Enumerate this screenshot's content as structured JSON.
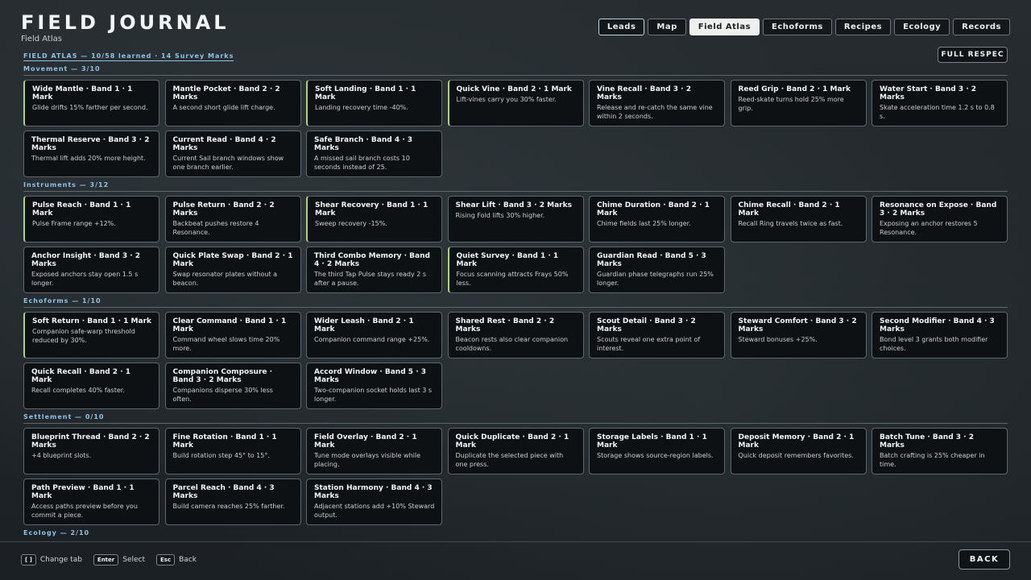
{
  "header": {
    "title": "FIELD JOURNAL",
    "subtitle": "Field Atlas"
  },
  "tabs": [
    {
      "label": "Leads",
      "state": "focus"
    },
    {
      "label": "Map",
      "state": ""
    },
    {
      "label": "Field Atlas",
      "state": "active"
    },
    {
      "label": "Echoforms",
      "state": ""
    },
    {
      "label": "Recipes",
      "state": ""
    },
    {
      "label": "Ecology",
      "state": ""
    },
    {
      "label": "Records",
      "state": ""
    }
  ],
  "summary": "FIELD ATLAS — 10/58 learned · 14 Survey Marks",
  "respec_label": "FULL RESPEC",
  "sections": [
    {
      "heading": "Movement — 3/10",
      "cards": [
        {
          "title": "Wide Mantle · Band 1 · 1 Mark",
          "desc": "Glide drifts 15% farther per second.",
          "learned": true
        },
        {
          "title": "Mantle Pocket · Band 2 · 2 Marks",
          "desc": "A second short glide lift charge.",
          "learned": false
        },
        {
          "title": "Soft Landing · Band 1 · 1 Mark",
          "desc": "Landing recovery time -40%.",
          "learned": true
        },
        {
          "title": "Quick Vine · Band 2 · 1 Mark",
          "desc": "Lift-vines carry you 30% faster.",
          "learned": true
        },
        {
          "title": "Vine Recall · Band 3 · 2 Marks",
          "desc": "Release and re-catch the same vine within 2 seconds.",
          "learned": false
        },
        {
          "title": "Reed Grip · Band 2 · 1 Mark",
          "desc": "Reed-skate turns hold 25% more grip.",
          "learned": false
        },
        {
          "title": "Water Start · Band 3 · 2 Marks",
          "desc": "Skate acceleration time 1.2 s to 0.8 s.",
          "learned": false
        },
        {
          "title": "Thermal Reserve · Band 3 · 2 Marks",
          "desc": "Thermal lift adds 20% more height.",
          "learned": false
        },
        {
          "title": "Current Read · Band 4 · 2 Marks",
          "desc": "Current Sail branch windows show one branch earlier.",
          "learned": false
        },
        {
          "title": "Safe Branch · Band 4 · 3 Marks",
          "desc": "A missed sail branch costs 10 seconds instead of 25.",
          "learned": false
        }
      ]
    },
    {
      "heading": "Instruments — 3/12",
      "cards": [
        {
          "title": "Pulse Reach · Band 1 · 1 Mark",
          "desc": "Pulse Frame range +12%.",
          "learned": true
        },
        {
          "title": "Pulse Return · Band 2 · 2 Marks",
          "desc": "Backbeat pushes restore 4 Resonance.",
          "learned": false
        },
        {
          "title": "Shear Recovery · Band 1 · 1 Mark",
          "desc": "Sweep recovery -15%.",
          "learned": true
        },
        {
          "title": "Shear Lift · Band 3 · 2 Marks",
          "desc": "Rising Fold lifts 30% higher.",
          "learned": false
        },
        {
          "title": "Chime Duration · Band 2 · 1 Mark",
          "desc": "Chime fields last 25% longer.",
          "learned": false
        },
        {
          "title": "Chime Recall · Band 2 · 1 Mark",
          "desc": "Recall Ring travels twice as fast.",
          "learned": false
        },
        {
          "title": "Resonance on Expose · Band 3 · 2 Marks",
          "desc": "Exposing an anchor restores 5 Resonance.",
          "learned": false
        },
        {
          "title": "Anchor Insight · Band 3 · 2 Marks",
          "desc": "Exposed anchors stay open 1.5 s longer.",
          "learned": false
        },
        {
          "title": "Quick Plate Swap · Band 2 · 1 Mark",
          "desc": "Swap resonator plates without a beacon.",
          "learned": false
        },
        {
          "title": "Third Combo Memory · Band 4 · 2 Marks",
          "desc": "The third Tap Pulse stays ready 2 s after a pause.",
          "learned": false
        },
        {
          "title": "Quiet Survey · Band 1 · 1 Mark",
          "desc": "Focus scanning attracts Frays 50% less.",
          "learned": true
        },
        {
          "title": "Guardian Read · Band 5 · 3 Marks",
          "desc": "Guardian phase telegraphs run 25% longer.",
          "learned": false
        }
      ]
    },
    {
      "heading": "Echoforms — 1/10",
      "cards": [
        {
          "title": "Soft Return · Band 1 · 1 Mark",
          "desc": "Companion safe-warp threshold reduced by 30%.",
          "learned": true
        },
        {
          "title": "Clear Command · Band 1 · 1 Mark",
          "desc": "Command wheel slows time 20% more.",
          "learned": false
        },
        {
          "title": "Wider Leash · Band 2 · 1 Mark",
          "desc": "Companion command range +25%.",
          "learned": false
        },
        {
          "title": "Shared Rest · Band 2 · 2 Marks",
          "desc": "Beacon rests also clear companion cooldowns.",
          "learned": false
        },
        {
          "title": "Scout Detail · Band 3 · 2 Marks",
          "desc": "Scouts reveal one extra point of interest.",
          "learned": false
        },
        {
          "title": "Steward Comfort · Band 3 · 2 Marks",
          "desc": "Steward bonuses +25%.",
          "learned": false
        },
        {
          "title": "Second Modifier · Band 4 · 3 Marks",
          "desc": "Bond level 3 grants both modifier choices.",
          "learned": false
        },
        {
          "title": "Quick Recall · Band 2 · 1 Mark",
          "desc": "Recall completes 40% faster.",
          "learned": false
        },
        {
          "title": "Companion Composure · Band 3 · 2 Marks",
          "desc": "Companions disperse 30% less often.",
          "learned": false
        },
        {
          "title": "Accord Window · Band 5 · 3 Marks",
          "desc": "Two-companion socket holds last 3 s longer.",
          "learned": false
        }
      ]
    },
    {
      "heading": "Settlement — 0/10",
      "cards": [
        {
          "title": "Blueprint Thread · Band 2 · 2 Marks",
          "desc": "+4 blueprint slots.",
          "learned": false
        },
        {
          "title": "Fine Rotation · Band 1 · 1 Mark",
          "desc": "Build rotation step 45° to 15°.",
          "learned": false
        },
        {
          "title": "Field Overlay · Band 2 · 1 Mark",
          "desc": "Tune mode overlays visible while placing.",
          "learned": false
        },
        {
          "title": "Quick Duplicate · Band 2 · 1 Mark",
          "desc": "Duplicate the selected piece with one press.",
          "learned": false
        },
        {
          "title": "Storage Labels · Band 1 · 1 Mark",
          "desc": "Storage shows source-region labels.",
          "learned": false
        },
        {
          "title": "Deposit Memory · Band 2 · 1 Mark",
          "desc": "Quick deposit remembers favorites.",
          "learned": false
        },
        {
          "title": "Batch Tune · Band 3 · 2 Marks",
          "desc": "Batch crafting is 25% cheaper in time.",
          "learned": false
        },
        {
          "title": "Path Preview · Band 1 · 1 Mark",
          "desc": "Access paths preview before you commit a piece.",
          "learned": false
        },
        {
          "title": "Parcel Reach · Band 4 · 3 Marks",
          "desc": "Build camera reaches 25% farther.",
          "learned": false
        },
        {
          "title": "Station Harmony · Band 4 · 3 Marks",
          "desc": "Adjacent stations add +10% Steward output.",
          "learned": false
        }
      ]
    },
    {
      "heading": "Ecology — 2/10",
      "cards": []
    }
  ],
  "footer": {
    "hints": [
      {
        "key": "[ ]",
        "label": "Change tab"
      },
      {
        "key": "Enter",
        "label": "Select"
      },
      {
        "key": "Esc",
        "label": "Back"
      }
    ],
    "back_label": "BACK"
  }
}
